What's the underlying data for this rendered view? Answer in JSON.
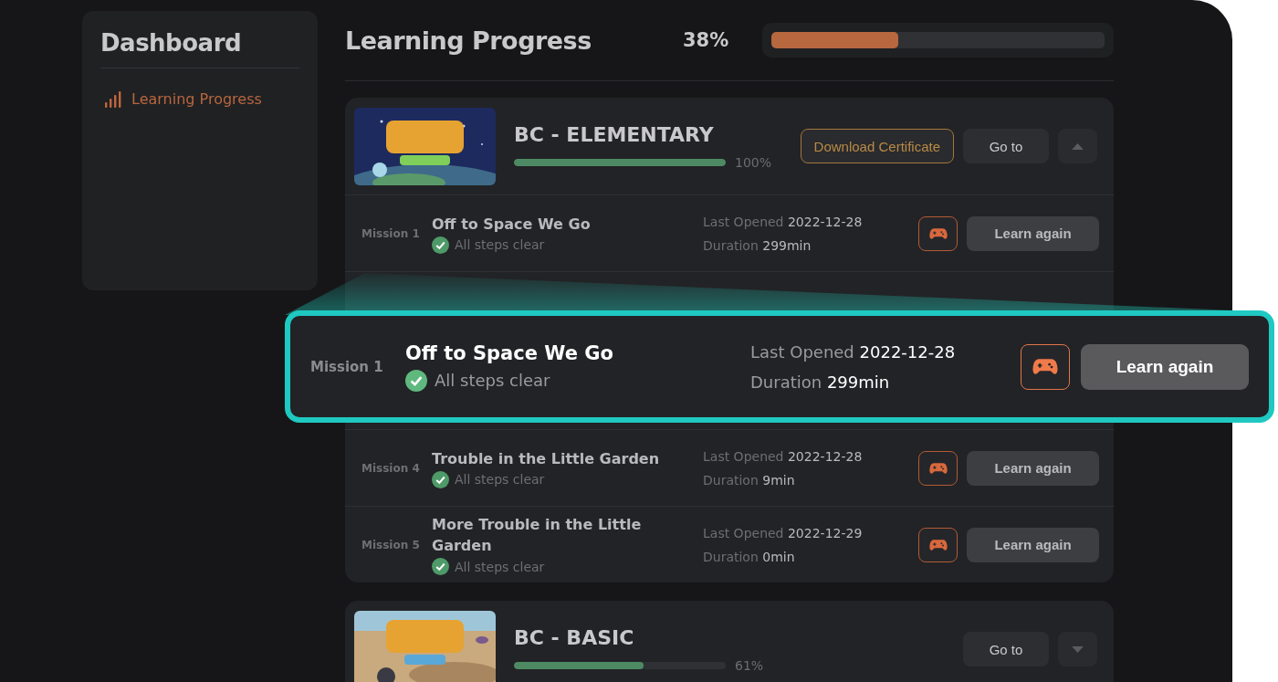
{
  "sidebar": {
    "title": "Dashboard",
    "items": [
      {
        "label": "Learning Progress",
        "selected": true
      }
    ]
  },
  "header": {
    "title": "Learning Progress",
    "percent": "38%",
    "level": 0.38
  },
  "courses": [
    {
      "title": "BC - ELEMENTARY",
      "percent": "100%",
      "level": 1.0,
      "expanded": true,
      "certificate_button": "Download Certificate",
      "goto_button": "Go to",
      "missions": [
        {
          "label": "Mission 1",
          "title": "Off to Space We Go",
          "status": "All steps clear",
          "cleared": true,
          "opened_label": "Last Opened",
          "opened": "2022-12-28",
          "duration_label": "Duration",
          "duration": "299min",
          "button": "Learn again"
        },
        {
          "label": "Mission 4",
          "title": "Trouble in the Little Garden",
          "status": "All steps clear",
          "cleared": true,
          "opened_label": "Last Opened",
          "opened": "2022-12-28",
          "duration_label": "Duration",
          "duration": "9min",
          "button": "Learn again"
        },
        {
          "label": "Mission 5",
          "title": "More Trouble in the Little Garden",
          "status": "All steps clear",
          "cleared": true,
          "opened_label": "Last Opened",
          "opened": "2022-12-29",
          "duration_label": "Duration",
          "duration": "0min",
          "button": "Learn again"
        }
      ]
    },
    {
      "title": "BC - BASIC",
      "percent": "61%",
      "level": 0.61,
      "expanded": false,
      "goto_button": "Go to"
    }
  ],
  "callout": {
    "label": "Mission 1",
    "title": "Off to Space We Go",
    "status": "All steps clear",
    "cleared": true,
    "opened_label": "Last Opened",
    "opened": "2022-12-28",
    "duration_label": "Duration",
    "duration": "299min",
    "button": "Learn again"
  }
}
